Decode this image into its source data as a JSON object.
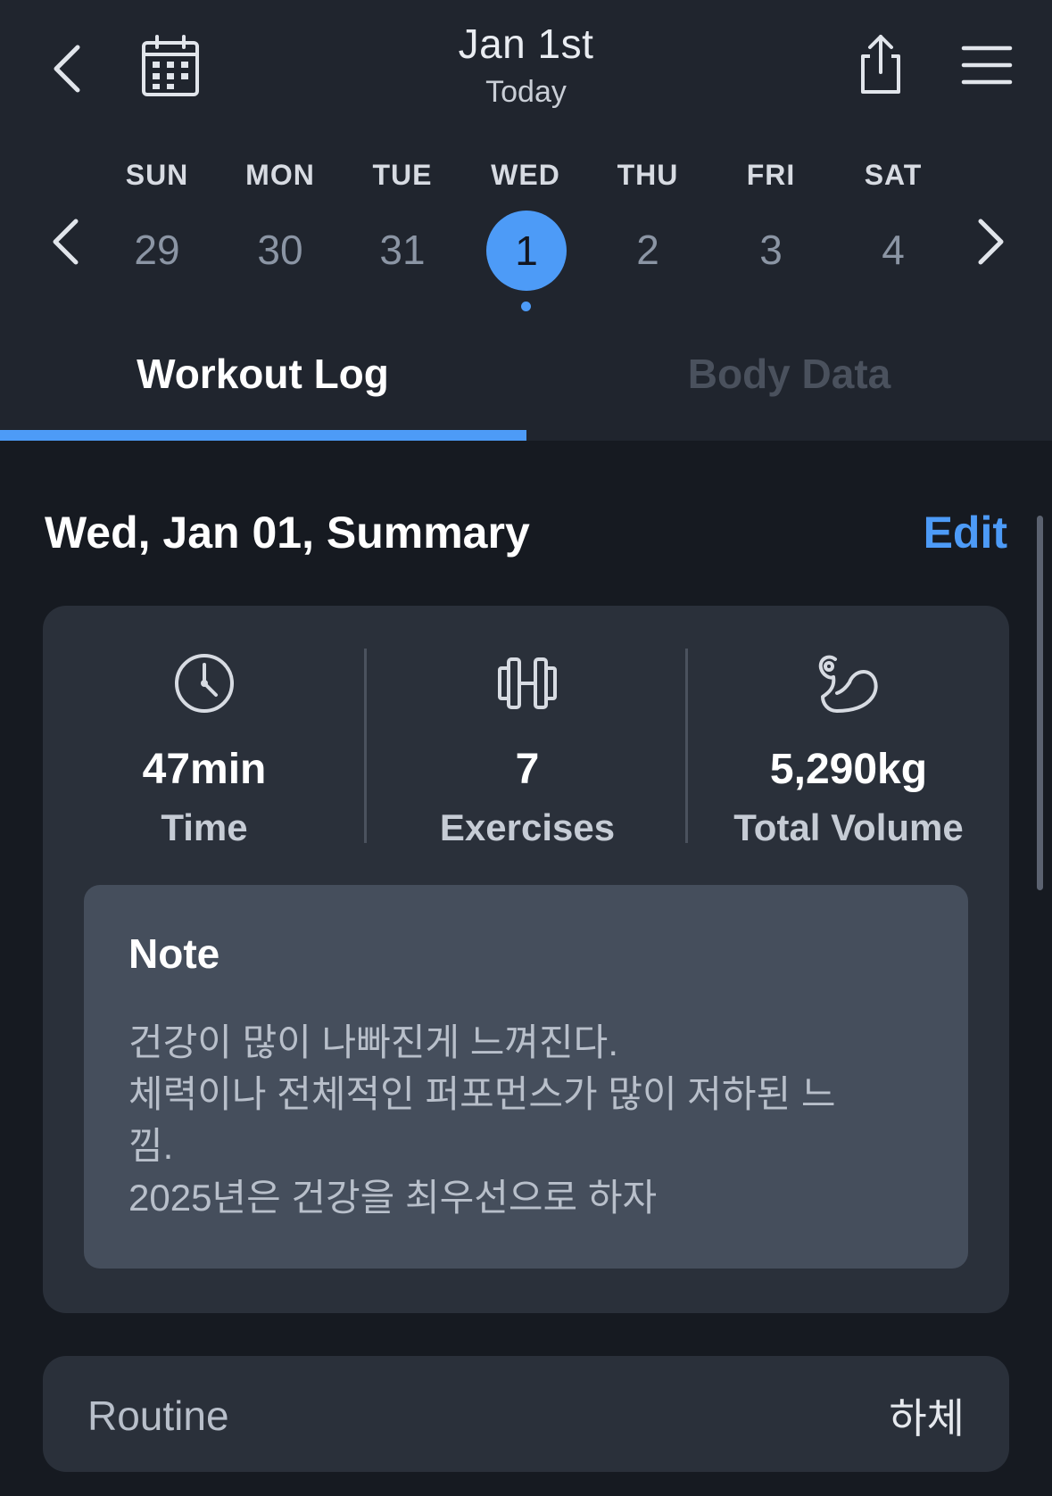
{
  "header": {
    "title": "Jan 1st",
    "subtitle": "Today",
    "icons": {
      "back": "chevron-left-icon",
      "calendar": "calendar-icon",
      "share": "share-icon",
      "menu": "hamburger-menu-icon"
    }
  },
  "week": {
    "days": [
      "SUN",
      "MON",
      "TUE",
      "WED",
      "THU",
      "FRI",
      "SAT"
    ],
    "dates": [
      "29",
      "30",
      "31",
      "1",
      "2",
      "3",
      "4"
    ],
    "selected_index": 3
  },
  "tabs": [
    {
      "label": "Workout Log",
      "active": true
    },
    {
      "label": "Body Data",
      "active": false
    }
  ],
  "summary": {
    "title": "Wed, Jan 01, Summary",
    "edit_label": "Edit",
    "stats": [
      {
        "icon": "clock-icon",
        "value": "47min",
        "label": "Time"
      },
      {
        "icon": "dumbbell-icon",
        "value": "7",
        "label": "Exercises"
      },
      {
        "icon": "flexed-bicep-icon",
        "value": "5,290kg",
        "label": "Total Volume"
      }
    ],
    "note": {
      "title": "Note",
      "body": "건강이 많이 나빠진게 느껴진다.\n체력이나 전체적인 퍼포먼스가 많이 저하된 느\n낌.\n2025년은 건강을 최우선으로 하자"
    }
  },
  "routine": {
    "label": "Routine",
    "value": "하체"
  },
  "colors": {
    "accent": "#4d9bf7",
    "header_bg": "#20252e",
    "page_bg": "#161a21",
    "card_bg": "#2a303a",
    "note_bg": "#454e5c"
  }
}
